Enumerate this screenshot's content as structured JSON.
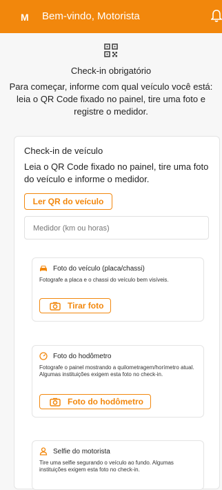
{
  "header": {
    "avatar_letter": "M",
    "title": "Bem-vindo, Motorista",
    "bell_icon": "bell-icon"
  },
  "intro": {
    "icon": "qr-code-icon",
    "title": "Check-in obrigatório",
    "description": "Para começar, informe com qual veículo você está: leia o QR Code fixado no painel, tire uma foto e registre o medidor."
  },
  "card": {
    "title": "Check-in de veículo",
    "description": "Leia o QR Code fixado no painel, tire uma foto do veículo e informe o medidor.",
    "qr_button": "Ler QR do veículo",
    "medidor_placeholder": "Medidor (km ou horas)",
    "sections": [
      {
        "icon": "car-icon",
        "title": "Foto do veículo (placa/chassi)",
        "description": "Fotografe a placa e o chassi do veículo bem visíveis.",
        "button": "Tirar foto"
      },
      {
        "icon": "gauge-icon",
        "title": "Foto do hodômetro",
        "description": "Fotografe o painel mostrando a quilometragem/horímetro atual. Algumas instituições exigem esta foto no check-in.",
        "button": "Foto do hodômetro"
      },
      {
        "icon": "user-icon",
        "title": "Selfie do motorista",
        "description": "Tire uma selfie segurando o veículo ao fundo. Algumas instituições exigem esta foto no check-in."
      }
    ]
  },
  "colors": {
    "accent": "#f2870c",
    "background": "#f7f7f7"
  }
}
